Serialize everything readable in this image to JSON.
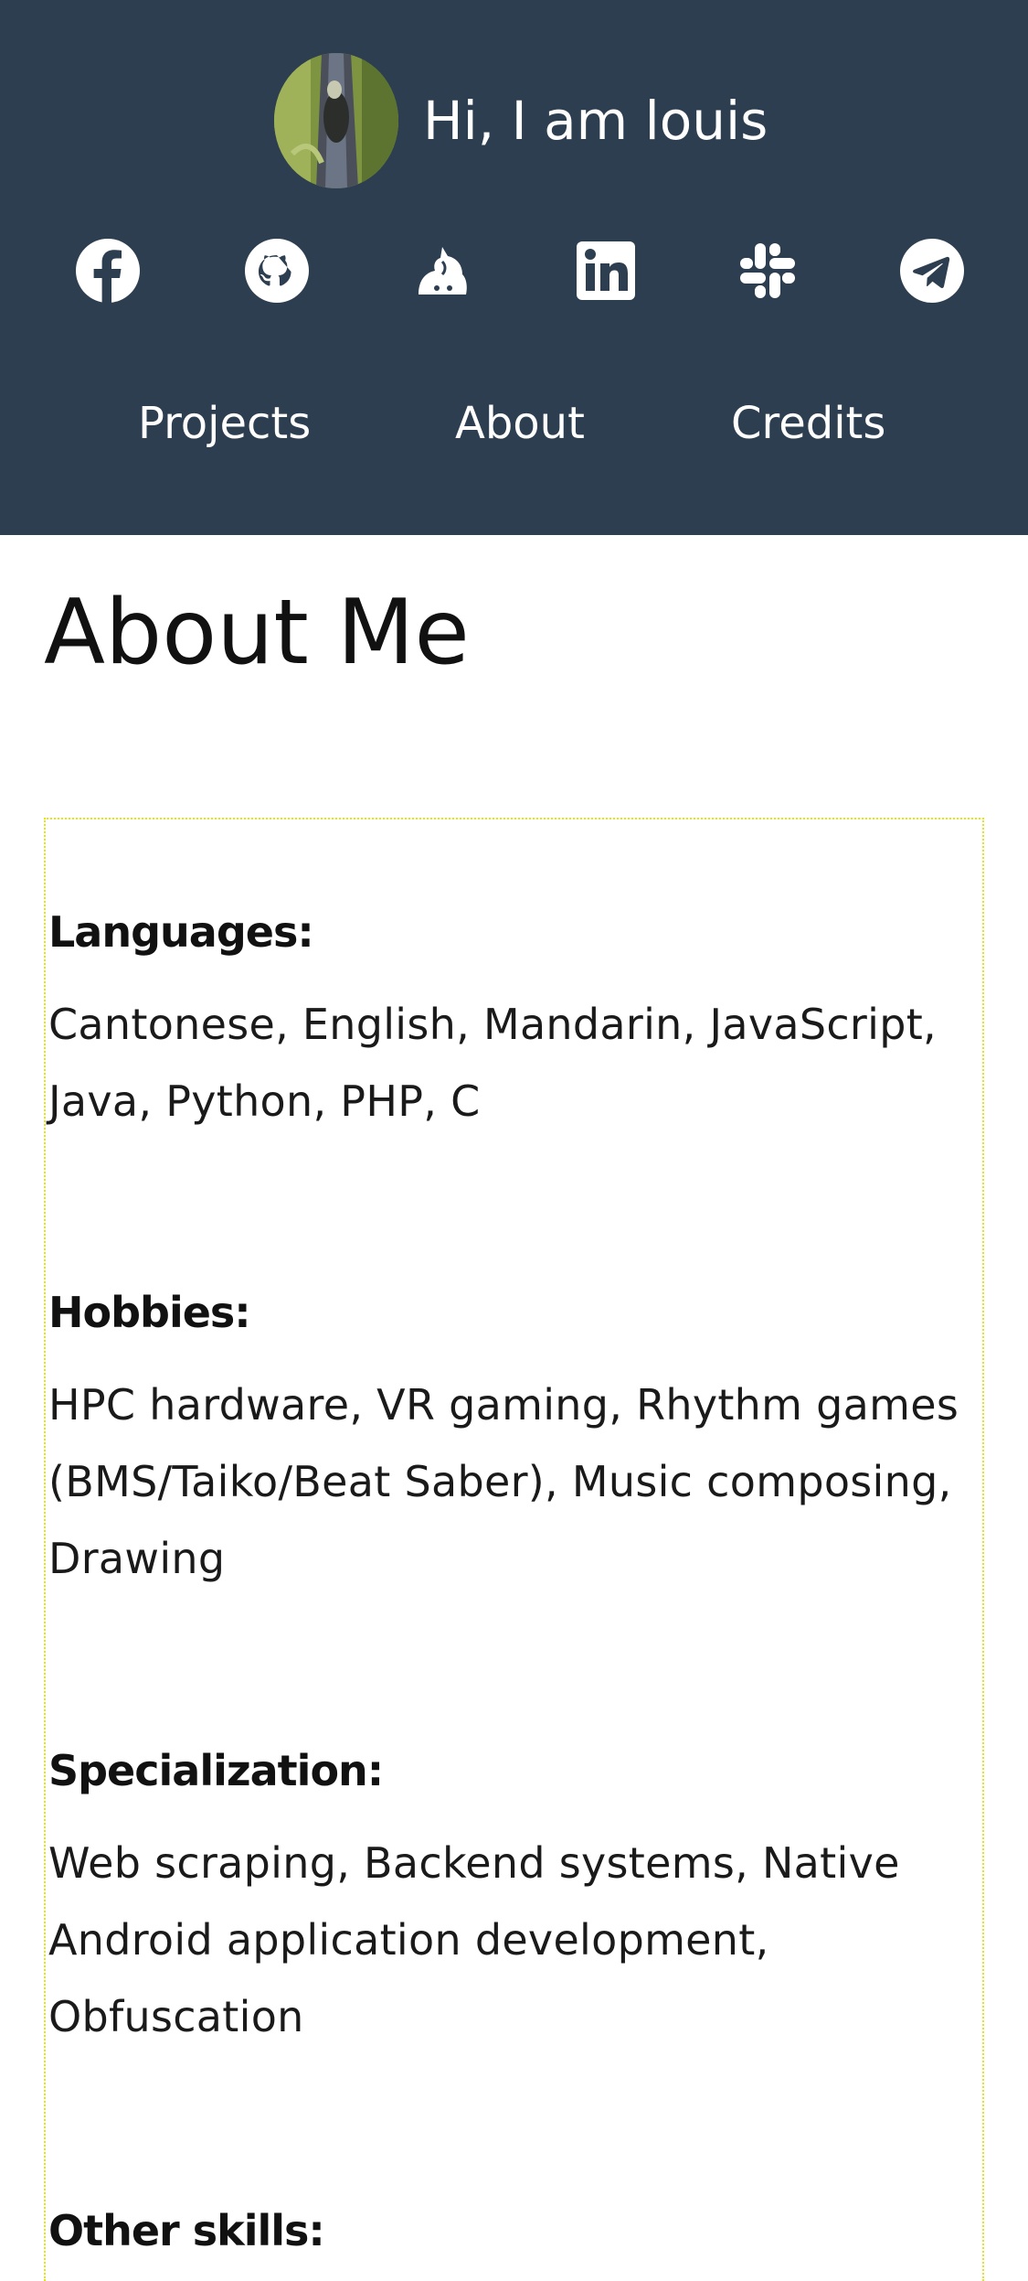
{
  "header": {
    "greeting": "Hi, I am louis",
    "social_icons": [
      {
        "name": "facebook-icon"
      },
      {
        "name": "github-icon"
      },
      {
        "name": "gitee-icon"
      },
      {
        "name": "linkedin-icon"
      },
      {
        "name": "slack-icon"
      },
      {
        "name": "telegram-icon"
      }
    ],
    "nav": [
      {
        "label": "Projects"
      },
      {
        "label": "About"
      },
      {
        "label": "Credits"
      }
    ],
    "background_color": "#2d3e50"
  },
  "main": {
    "title": "About Me",
    "sections": [
      {
        "heading": "Languages:",
        "body": "Cantonese, English, Mandarin, JavaScript, Java, Python, PHP, C"
      },
      {
        "heading": "Hobbies:",
        "body": "HPC hardware, VR gaming, Rhythm games (BMS/Taiko/Beat Saber), Music composing, Drawing"
      },
      {
        "heading": "Specialization:",
        "body": "Web scraping, Backend systems, Native Android application development, Obfuscation"
      },
      {
        "heading": "Other skills:",
        "body": ""
      }
    ]
  }
}
